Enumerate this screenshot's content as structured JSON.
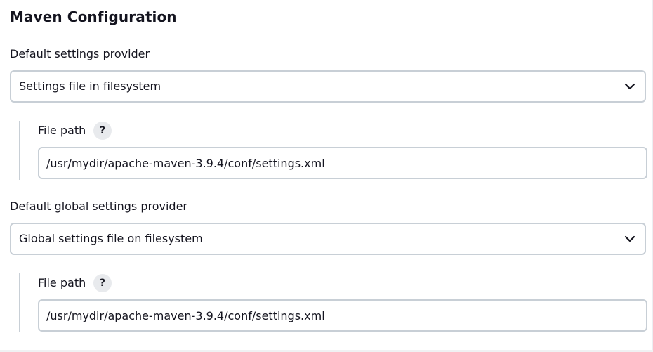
{
  "section": {
    "title": "Maven Configuration"
  },
  "settings_provider": {
    "label": "Default settings provider",
    "selected": "Settings file in filesystem",
    "file_path": {
      "label": "File path",
      "help": "?",
      "value": "/usr/mydir/apache-maven-3.9.4/conf/settings.xml"
    }
  },
  "global_settings_provider": {
    "label": "Default global settings provider",
    "selected": "Global settings file on filesystem",
    "file_path": {
      "label": "File path",
      "help": "?",
      "value": "/usr/mydir/apache-maven-3.9.4/conf/settings.xml"
    }
  },
  "icons": {
    "dropdown": "chevron-down-icon",
    "help": "help-icon"
  }
}
